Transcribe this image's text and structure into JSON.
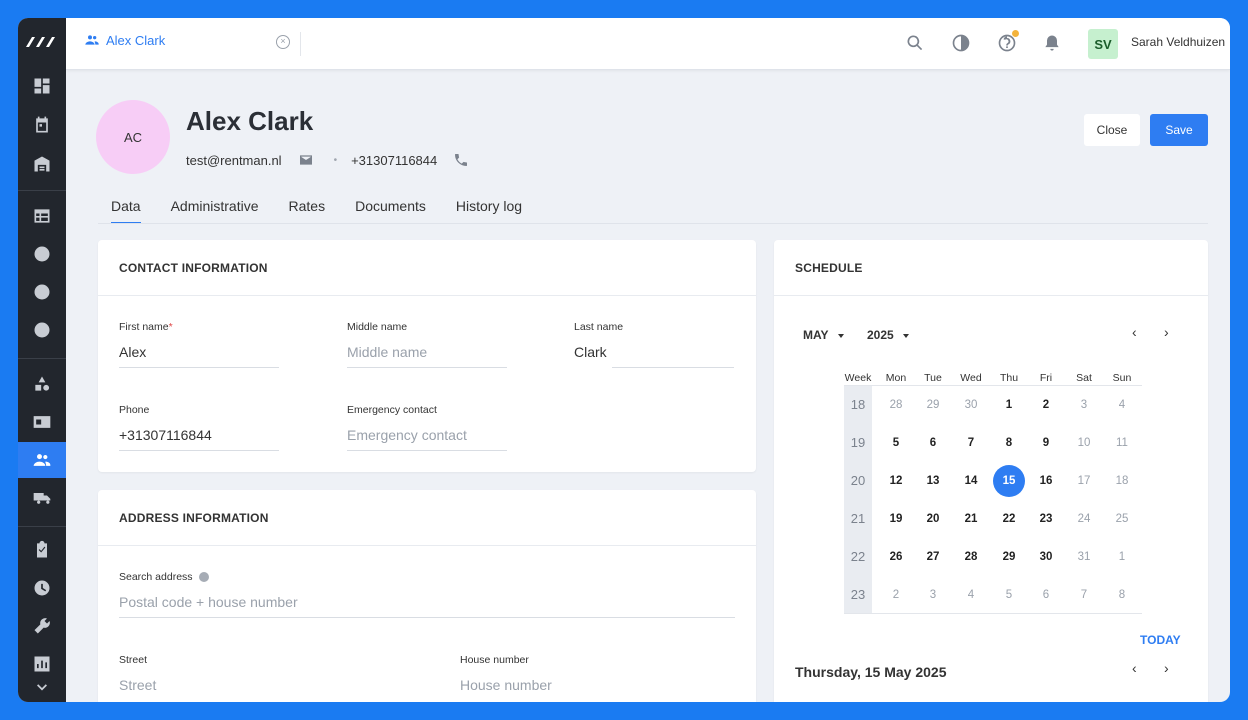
{
  "topbar": {
    "tab_label": "Alex Clark",
    "tab_close": "×",
    "user_initials": "SV",
    "user_name": "Sarah Veldhuizen"
  },
  "header": {
    "initials": "AC",
    "name": "Alex Clark",
    "email": "test@rentman.nl",
    "separator": "•",
    "phone": "+31307116844",
    "close_label": "Close",
    "save_label": "Save"
  },
  "tabs": [
    "Data",
    "Administrative",
    "Rates",
    "Documents",
    "History log"
  ],
  "contact": {
    "title": "CONTACT INFORMATION",
    "first_name_label": "First name",
    "required_mark": "*",
    "first_name_value": "Alex",
    "middle_name_label": "Middle name",
    "middle_name_placeholder": "Middle name",
    "last_name_label": "Last name",
    "last_name_value": "Clark",
    "phone_label": "Phone",
    "phone_value": "+31307116844",
    "emergency_label": "Emergency contact",
    "emergency_placeholder": "Emergency contact"
  },
  "address": {
    "title": "ADDRESS INFORMATION",
    "search_label": "Search address",
    "search_placeholder": "Postal code + house number",
    "street_label": "Street",
    "street_placeholder": "Street",
    "house_label": "House number",
    "house_placeholder": "House number"
  },
  "schedule": {
    "title": "SCHEDULE",
    "month": "MAY",
    "year": "2025",
    "prev": "‹",
    "next": "›",
    "headers": [
      "Week",
      "Mon",
      "Tue",
      "Wed",
      "Thu",
      "Fri",
      "Sat",
      "Sun"
    ],
    "weeks": [
      {
        "week": "18",
        "days": [
          {
            "d": "28",
            "dim": true
          },
          {
            "d": "29",
            "dim": true
          },
          {
            "d": "30",
            "dim": true
          },
          {
            "d": "1"
          },
          {
            "d": "2"
          },
          {
            "d": "3",
            "dim": true
          },
          {
            "d": "4",
            "dim": true
          }
        ]
      },
      {
        "week": "19",
        "days": [
          {
            "d": "5"
          },
          {
            "d": "6"
          },
          {
            "d": "7"
          },
          {
            "d": "8"
          },
          {
            "d": "9"
          },
          {
            "d": "10",
            "dim": true
          },
          {
            "d": "11",
            "dim": true
          }
        ]
      },
      {
        "week": "20",
        "days": [
          {
            "d": "12"
          },
          {
            "d": "13"
          },
          {
            "d": "14"
          },
          {
            "d": "15",
            "today": true
          },
          {
            "d": "16"
          },
          {
            "d": "17",
            "dim": true
          },
          {
            "d": "18",
            "dim": true
          }
        ]
      },
      {
        "week": "21",
        "days": [
          {
            "d": "19"
          },
          {
            "d": "20"
          },
          {
            "d": "21"
          },
          {
            "d": "22"
          },
          {
            "d": "23"
          },
          {
            "d": "24",
            "dim": true
          },
          {
            "d": "25",
            "dim": true
          }
        ]
      },
      {
        "week": "22",
        "days": [
          {
            "d": "26"
          },
          {
            "d": "27"
          },
          {
            "d": "28"
          },
          {
            "d": "29"
          },
          {
            "d": "30"
          },
          {
            "d": "31",
            "dim": true
          },
          {
            "d": "1",
            "dim": true
          }
        ]
      },
      {
        "week": "23",
        "days": [
          {
            "d": "2",
            "dim": true
          },
          {
            "d": "3",
            "dim": true
          },
          {
            "d": "4",
            "dim": true
          },
          {
            "d": "5",
            "dim": true
          },
          {
            "d": "6",
            "dim": true
          },
          {
            "d": "7",
            "dim": true
          },
          {
            "d": "8",
            "dim": true
          }
        ]
      }
    ],
    "today_label": "TODAY",
    "selected_date": "Thursday, 15 May 2025"
  },
  "sidebar_icons": [
    "dashboard-icon",
    "calendar-icon",
    "warehouse-icon",
    "table-icon",
    "contact-icon",
    "exchange-icon",
    "money-icon",
    "shapes-icon",
    "id-card-icon",
    "crew-icon",
    "truck-icon",
    "clipboard-icon",
    "clock-icon",
    "wrench-icon",
    "report-icon",
    "chevron-down-icon"
  ],
  "colors": {
    "accent": "#2e7df2",
    "rail": "#22262d",
    "avatar_bg": "#f7cdf6",
    "user_badge": "#c6f0cf"
  }
}
